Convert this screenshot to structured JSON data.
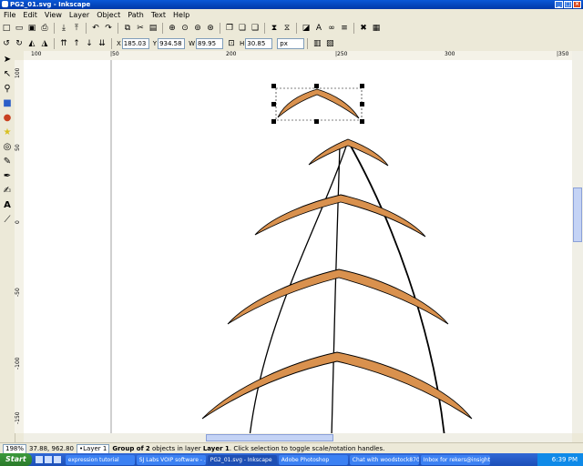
{
  "window": {
    "title": "PG2_01.svg - Inkscape",
    "minimize": "_",
    "maximize": "□",
    "close": "×"
  },
  "menu": [
    "File",
    "Edit",
    "View",
    "Layer",
    "Object",
    "Path",
    "Text",
    "Help"
  ],
  "toolbar_main": {
    "icons": [
      "new-icon",
      "open-icon",
      "save-icon",
      "print-icon",
      "import-icon",
      "export-icon",
      "undo-icon",
      "redo-icon",
      "copy-icon",
      "cut-icon",
      "paste-icon",
      "zoom-selection-icon",
      "zoom-drawing-icon",
      "zoom-page-icon",
      "zoom-width-icon",
      "duplicate-icon",
      "clone-icon",
      "unlink-clone-icon",
      "group-icon",
      "ungroup-icon",
      "fill-stroke-icon",
      "text-font-icon",
      "xml-editor-icon",
      "align-icon",
      "transform-icon",
      "preferences-icon"
    ]
  },
  "toolbar_select": {
    "x_label": "X",
    "x_value": "185.03",
    "y_label": "Y",
    "y_value": "934.58",
    "w_label": "W",
    "w_value": "89.95",
    "h_label": "H",
    "h_value": "30.85",
    "units": "px"
  },
  "tools": [
    "selector-icon",
    "node-icon",
    "zoom-icon",
    "rectangle-icon",
    "ellipse-icon",
    "star-icon",
    "spiral-icon",
    "pencil-icon",
    "pen-icon",
    "calligraphy-icon",
    "text-icon",
    "dropper-icon"
  ],
  "ruler": {
    "h_labels": [
      "100",
      "|50",
      "200",
      "|250",
      "300",
      "|350"
    ],
    "v_labels": [
      "100",
      "50",
      "0",
      "-50",
      "-100",
      "-150"
    ]
  },
  "status": {
    "zoom": "198%",
    "coords": "37.88, 962.80",
    "layer": "•Layer 1",
    "message_prefix": "Group of",
    "message_count": "2",
    "message_middle": "objects in layer",
    "message_layer": "Layer 1",
    "message_suffix": ". Click selection to toggle scale/rotation handles."
  },
  "taskbar": {
    "start": "Start",
    "tasks": [
      "expression tutorial",
      "SJ Labs VOIP software - ...",
      "PG2_01.svg - Inkscape",
      "Adobe Photoshop",
      "Chat with woodstock870...",
      "Inbox for rekers@insight..."
    ],
    "time": "6:39 PM"
  },
  "colors": {
    "fill": "#d9914e",
    "stroke": "#000000",
    "titlebar": "#0a58d8",
    "taskbar": "#245edb"
  }
}
